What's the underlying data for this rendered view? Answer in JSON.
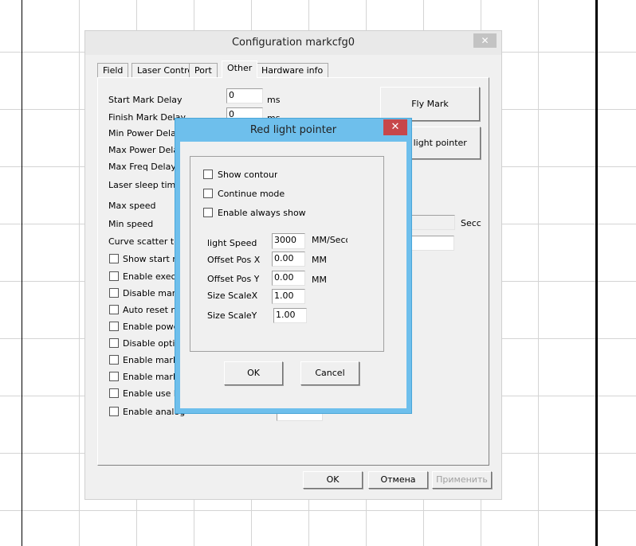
{
  "main_window": {
    "title": "Configuration markcfg0",
    "close": "✕",
    "tabs": [
      "Field",
      "Laser Contro",
      "Port",
      "Other",
      "Hardware info"
    ],
    "active_tab": "Other",
    "fields": [
      {
        "label": "Start Mark Delay",
        "value": "0",
        "unit": "ms"
      },
      {
        "label": "Finish Mark Delay",
        "value": "0",
        "unit": "ms"
      },
      {
        "label": "Min Power Delay"
      },
      {
        "label": "Max Power Delay"
      },
      {
        "label": "Max Freq Delay"
      },
      {
        "label": "Laser sleep time"
      },
      {
        "label": "Max speed"
      },
      {
        "label": "Min speed"
      },
      {
        "label": "Curve scatter tole"
      }
    ],
    "checkboxes": [
      "Show start ma",
      "Enable execu",
      "Disable mark",
      "Auto reset ma",
      "Enable power",
      "Disable optimi",
      "Enable markir",
      "Enable markir",
      "Enable use ha",
      "Enable analog"
    ],
    "right_buttons": {
      "fly_mark": "Fly Mark",
      "red_light": "Red light pointer"
    },
    "sec_unit": "Secc",
    "footer": {
      "ok": "OK",
      "cancel": "Отмена",
      "apply": "Применить"
    }
  },
  "dialog": {
    "title": "Red light pointer",
    "close": "✕",
    "checkboxes": [
      {
        "label": "Show contour",
        "checked": false
      },
      {
        "label": "Continue mode",
        "checked": false
      },
      {
        "label": "Enable always show",
        "checked": false
      }
    ],
    "fields": [
      {
        "label": "light Speed",
        "value": "3000",
        "unit": "MM/Seco"
      },
      {
        "label": "Offset Pos X",
        "value": "0.00",
        "unit": "MM"
      },
      {
        "label": "Offset Pos Y",
        "value": "0.00",
        "unit": "MM"
      },
      {
        "label": "Size ScaleX",
        "value": "1.00"
      },
      {
        "label": "Size ScaleY",
        "value": "1.00"
      }
    ],
    "ok": "OK",
    "cancel": "Cancel"
  },
  "colors": {
    "dialog_frame": "#6ebfec",
    "close_red": "#c7474a"
  }
}
